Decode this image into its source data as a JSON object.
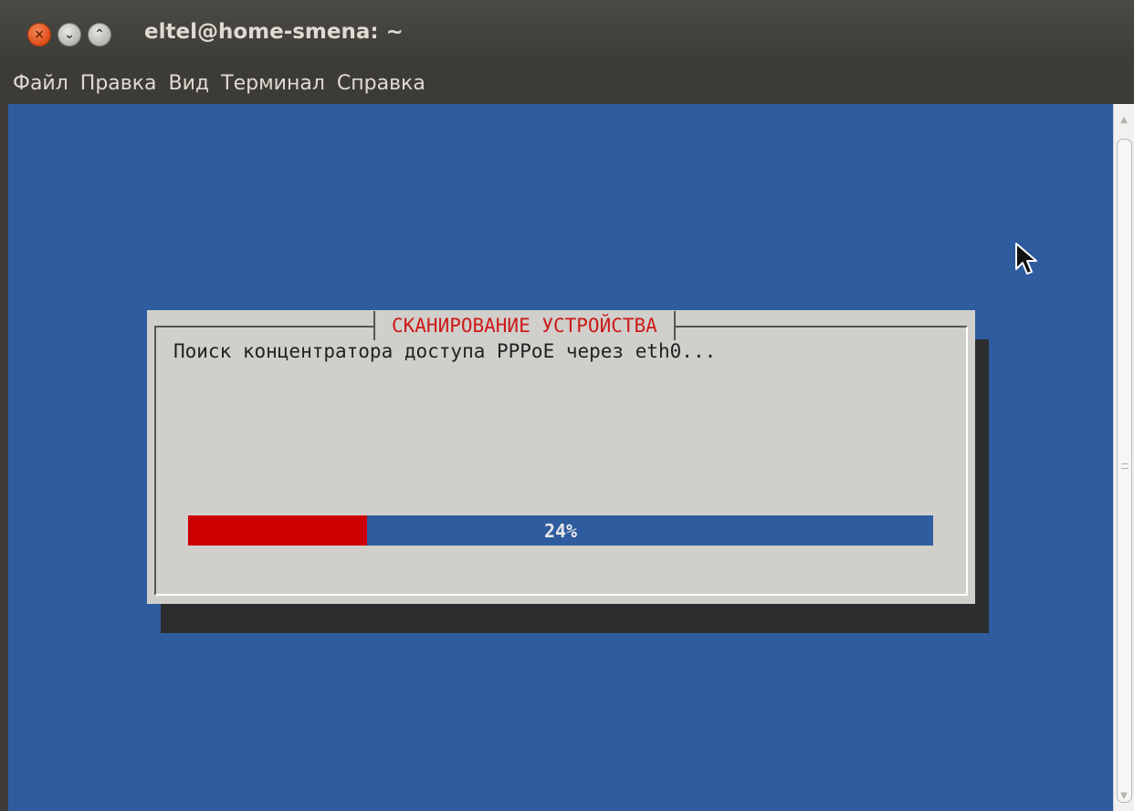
{
  "window": {
    "title": "eltel@home-smena: ~",
    "buttons": [
      "close",
      "minimize",
      "maximize"
    ]
  },
  "menubar": {
    "items": [
      {
        "label": "Файл"
      },
      {
        "label": "Правка"
      },
      {
        "label": "Вид"
      },
      {
        "label": "Терминал"
      },
      {
        "label": "Справка"
      }
    ]
  },
  "dialog": {
    "title": "СКАНИРОВАНИЕ УСТРОЙСТВА",
    "message": "Поиск концентратора доступа PPPoE через eth0...",
    "progress": {
      "value": 24,
      "label": "24%"
    }
  },
  "colors": {
    "terminal_bg": "#2f5c9f",
    "dialog_bg": "#d0cfcb",
    "dialog_title": "#cc1a1a",
    "progress_fill": "#cc0000",
    "window_chrome": "#3c3b37"
  },
  "icons": {
    "close": "close-icon",
    "minimize": "minimize-icon",
    "maximize": "maximize-icon",
    "cursor": "mouse-pointer-icon"
  }
}
